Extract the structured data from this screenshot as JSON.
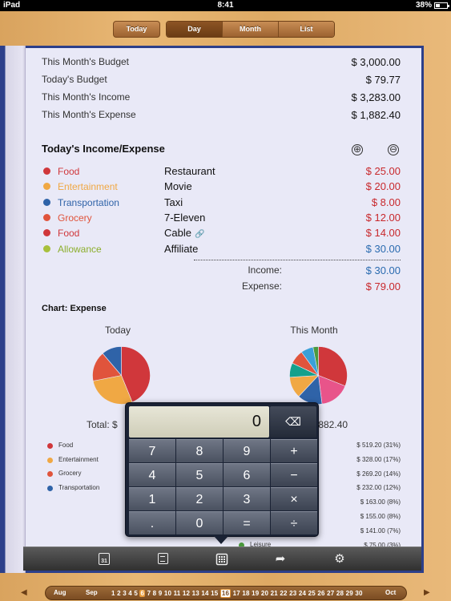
{
  "status": {
    "carrier": "iPad",
    "time": "8:41",
    "battery": "38%"
  },
  "nav": {
    "today": "Today",
    "day": "Day",
    "month": "Month",
    "list": "List",
    "active": "Day"
  },
  "summary": [
    {
      "label": "This Month's Budget",
      "value": "$ 3,000.00"
    },
    {
      "label": "Today's Budget",
      "value": "$ 79.77"
    },
    {
      "label": "This Month's Income",
      "value": "$ 3,283.00"
    },
    {
      "label": "This Month's Expense",
      "value": "$ 1,882.40"
    }
  ],
  "today_section": {
    "title": "Today's Income/Expense",
    "add_symbol": "⊕",
    "remove_symbol": "⊖"
  },
  "transactions": [
    {
      "category": "Food",
      "description": "Restaurant",
      "amount": "$ 25.00",
      "color": "#d0373b",
      "amount_color": "#c8282c",
      "attachment": false
    },
    {
      "category": "Entertainment",
      "description": "Movie",
      "amount": "$ 20.00",
      "color": "#f0a844",
      "amount_color": "#c8282c",
      "attachment": false
    },
    {
      "category": "Transportation",
      "description": "Taxi",
      "amount": "$ 8.00",
      "color": "#2f63a8",
      "amount_color": "#c8282c",
      "attachment": false
    },
    {
      "category": "Grocery",
      "description": "7-Eleven",
      "amount": "$ 12.00",
      "color": "#e0543c",
      "amount_color": "#c8282c",
      "attachment": false
    },
    {
      "category": "Food",
      "description": "Cable",
      "amount": "$ 14.00",
      "color": "#d0373b",
      "amount_color": "#c8282c",
      "attachment": true
    },
    {
      "category": "Allowance",
      "description": "Affiliate",
      "amount": "$ 30.00",
      "color": "#a8c03c",
      "amount_color": "#2a6bb0",
      "attachment": false
    }
  ],
  "totals": {
    "income_label": "Income:",
    "income_value": "$ 30.00",
    "expense_label": "Expense:",
    "expense_value": "$ 79.00",
    "income_color": "#2a6bb0",
    "expense_color": "#c8282c"
  },
  "chart_section": {
    "title": "Chart: Expense",
    "today_label": "Today",
    "month_label": "This Month",
    "today_total_prefix": "Total: $",
    "month_total_suffix": ",882.40",
    "left_legend": [
      {
        "name": "Food",
        "color": "#d0373b"
      },
      {
        "name": "Entertainment",
        "color": "#f0a844"
      },
      {
        "name": "Grocery",
        "color": "#e0543c"
      },
      {
        "name": "Transportation",
        "color": "#2f63a8"
      }
    ],
    "right_values": [
      "$ 519.20 (31%)",
      "$ 328.00 (17%)",
      "$ 269.20 (14%)",
      "$ 232.00 (12%)",
      "$ 163.00 (8%)",
      "$ 155.00 (8%)",
      "$ 141.00 (7%)",
      "$ 75.00 (3%)"
    ],
    "leisure_label": "Leisure",
    "leisure_color": "#4b9a3e"
  },
  "chart_data": [
    {
      "type": "pie",
      "title": "Today",
      "labels": [
        "Food",
        "Entertainment",
        "Grocery",
        "Transportation"
      ],
      "values": [
        39,
        25,
        15,
        10
      ],
      "colors": [
        "#d0373b",
        "#f0a844",
        "#e0543c",
        "#2f63a8"
      ]
    },
    {
      "type": "pie",
      "title": "This Month",
      "values": [
        31,
        17,
        14,
        12,
        8,
        8,
        7,
        3
      ],
      "colors": [
        "#d0373b",
        "#e8548a",
        "#2f63a8",
        "#f0a844",
        "#14a08c",
        "#e0543c",
        "#3aa0d8",
        "#4b9a3e"
      ]
    }
  ],
  "calculator": {
    "display": "0",
    "backspace_symbol": "⌫",
    "keys": [
      "7",
      "8",
      "9",
      "+",
      "4",
      "5",
      "6",
      "−",
      "1",
      "2",
      "3",
      "×",
      ".",
      "0",
      "=",
      "÷"
    ]
  },
  "toolbar": {
    "calendar_day": "31",
    "share_symbol": "➦",
    "settings_symbol": "⚙"
  },
  "datebar": {
    "left_arrow": "◀",
    "right_arrow": "▶",
    "prev_month": "Aug",
    "current_month": "Sep",
    "next_month": "Oct",
    "days": [
      "1",
      "2",
      "3",
      "4",
      "5",
      "6",
      "7",
      "8",
      "9",
      "10",
      "11",
      "12",
      "13",
      "14",
      "15",
      "16",
      "17",
      "18",
      "19",
      "20",
      "21",
      "22",
      "23",
      "24",
      "25",
      "26",
      "27",
      "28",
      "29",
      "30"
    ],
    "selected_day": "6",
    "today_day": "16"
  }
}
